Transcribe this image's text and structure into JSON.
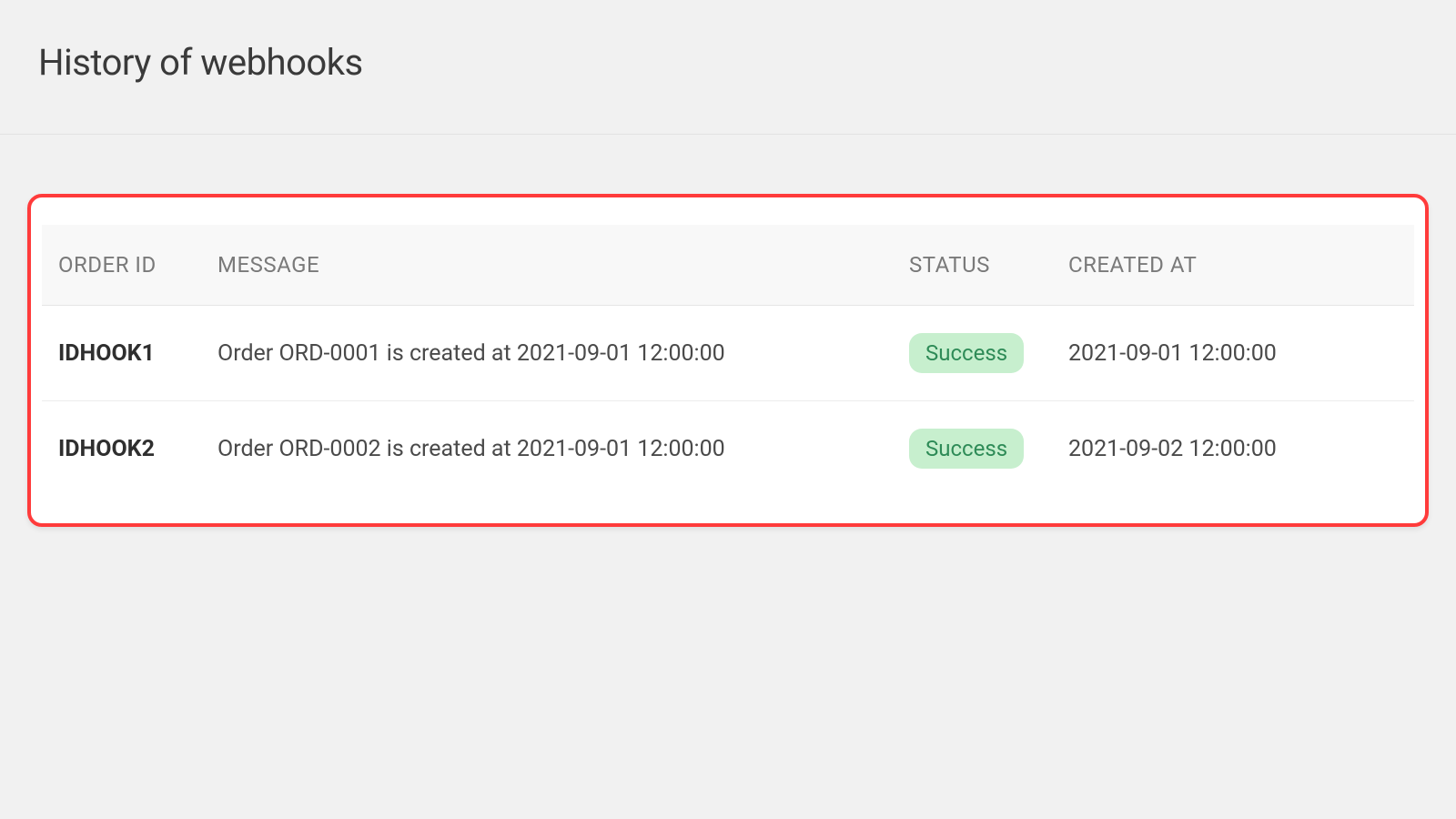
{
  "page": {
    "title": "History of webhooks"
  },
  "table": {
    "headers": {
      "order_id": "ORDER ID",
      "message": "MESSAGE",
      "status": "STATUS",
      "created_at": "CREATED AT"
    },
    "rows": [
      {
        "order_id": "IDHOOK1",
        "message": "Order ORD-0001 is created at 2021-09-01 12:00:00",
        "status": "Success",
        "created_at": "2021-09-01 12:00:00"
      },
      {
        "order_id": "IDHOOK2",
        "message": "Order ORD-0002 is created at 2021-09-01 12:00:00",
        "status": "Success",
        "created_at": "2021-09-02 12:00:00"
      }
    ]
  }
}
